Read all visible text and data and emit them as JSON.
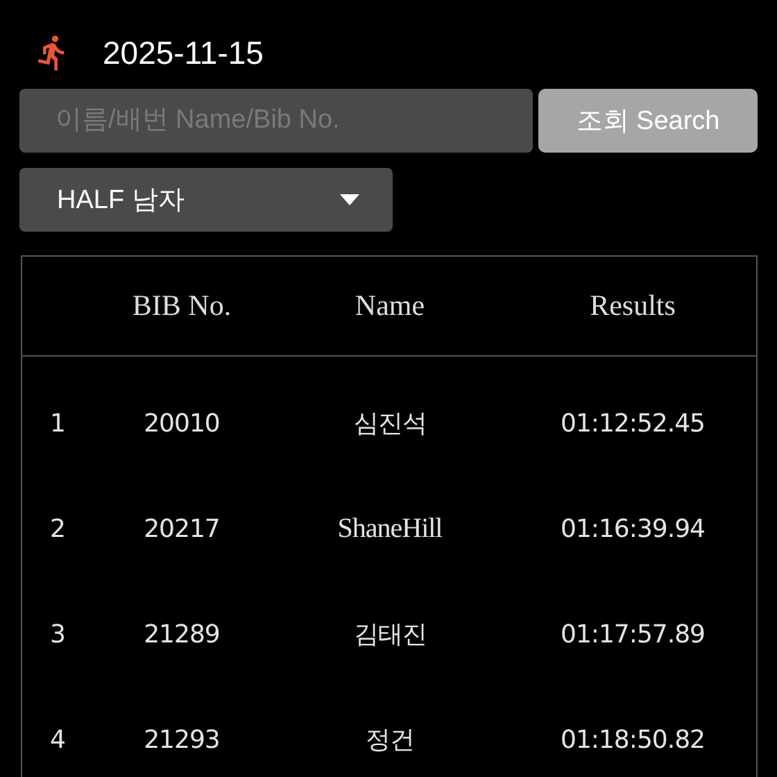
{
  "header": {
    "date": "2025-11-15"
  },
  "search": {
    "placeholder": "이름/배번 Name/Bib No.",
    "button": "조회 Search"
  },
  "category_select": {
    "value": "HALF 남자"
  },
  "table": {
    "columns": [
      "BIB No.",
      "Name",
      "Results"
    ],
    "rows": [
      {
        "rank": "1",
        "bib": "20010",
        "name": "심진석",
        "result": "01:12:52.45"
      },
      {
        "rank": "2",
        "bib": "20217",
        "name": "ShaneHill",
        "result": "01:16:39.94"
      },
      {
        "rank": "3",
        "bib": "21289",
        "name": "김태진",
        "result": "01:17:57.89"
      },
      {
        "rank": "4",
        "bib": "21293",
        "name": "정건",
        "result": "01:18:50.82"
      }
    ]
  }
}
